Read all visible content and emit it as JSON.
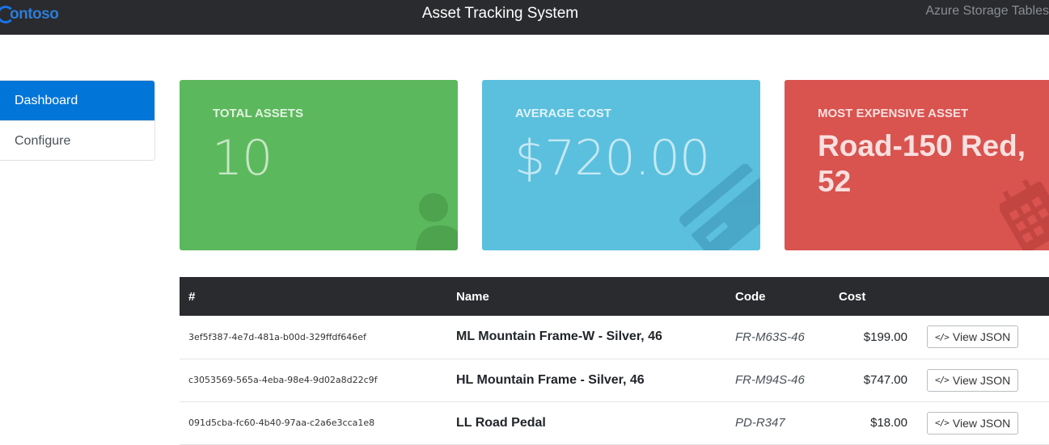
{
  "header": {
    "brand": "ontoso",
    "title": "Asset Tracking System",
    "right_text": "Azure Storage Tables"
  },
  "sidebar": {
    "items": [
      {
        "label": "Dashboard",
        "active": true
      },
      {
        "label": "Configure",
        "active": false
      }
    ]
  },
  "cards": {
    "total_assets": {
      "label": "TOTAL ASSETS",
      "value": "10",
      "color": "#5cb85c",
      "icon": "user-icon"
    },
    "average_cost": {
      "label": "AVERAGE COST",
      "value": "$720.00",
      "color": "#5bc0de",
      "icon": "credit-card-icon"
    },
    "most_expensive": {
      "label": "MOST EXPENSIVE ASSET",
      "value": "Road-150 Red, 52",
      "color": "#d9534f",
      "icon": "calendar-icon"
    }
  },
  "table": {
    "headers": {
      "id": "#",
      "name": "Name",
      "code": "Code",
      "cost": "Cost"
    },
    "view_label": "View JSON",
    "rows": [
      {
        "id": "3ef5f387-4e7d-481a-b00d-329ffdf646ef",
        "name": "ML Mountain Frame-W - Silver, 46",
        "code": "FR-M63S-46",
        "cost": "$199.00"
      },
      {
        "id": "c3053569-565a-4eba-98e4-9d02a8d22c9f",
        "name": "HL Mountain Frame - Silver, 46",
        "code": "FR-M94S-46",
        "cost": "$747.00"
      },
      {
        "id": "091d5cba-fc60-4b40-97aa-c2a6e3cca1e8",
        "name": "LL Road Pedal",
        "code": "PD-R347",
        "cost": "$18.00"
      }
    ]
  }
}
